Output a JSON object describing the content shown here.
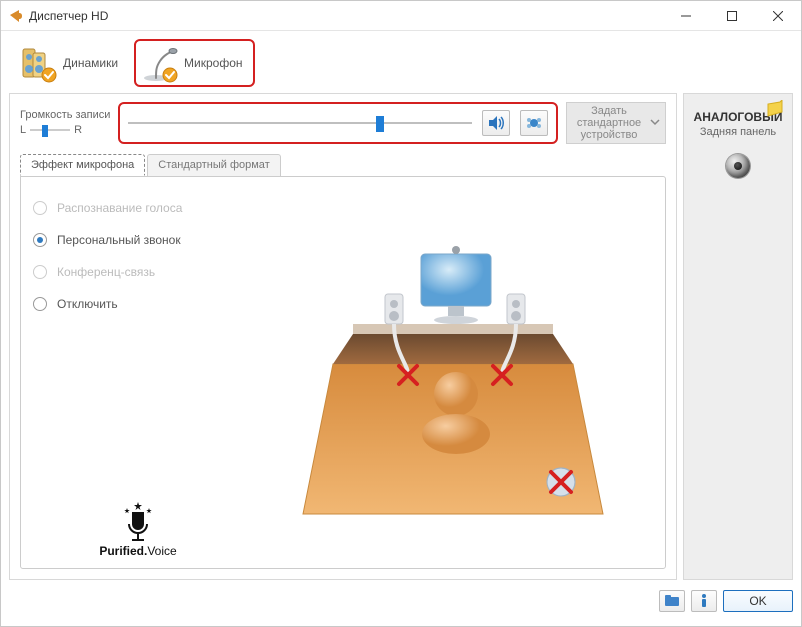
{
  "window": {
    "title": "Диспетчер HD"
  },
  "tabs": {
    "speakers": "Динамики",
    "microphone": "Микрофон"
  },
  "volume": {
    "label": "Громкость записи",
    "left_label": "L",
    "right_label": "R",
    "lr_balance_percent": 30,
    "level_percent": 72
  },
  "icon_btns": {
    "sound_preview": "sound-icon",
    "noise_suppress": "noise-icon"
  },
  "set_default": {
    "label": "Задать стандартное устройство"
  },
  "inner_tabs": {
    "effect": "Эффект микрофона",
    "format": "Стандартный формат"
  },
  "effects": {
    "voice_recognition": "Распознавание голоса",
    "personal_call": "Персональный звонок",
    "conference": "Конференц-связь",
    "disable": "Отключить",
    "selected": "personal_call"
  },
  "purified": {
    "brand_bold": "Purified.",
    "brand_rest": "Voice"
  },
  "right_panel": {
    "title": "АНАЛОГОВЫЙ",
    "subtitle": "Задняя панель"
  },
  "buttons": {
    "ok": "OK"
  }
}
